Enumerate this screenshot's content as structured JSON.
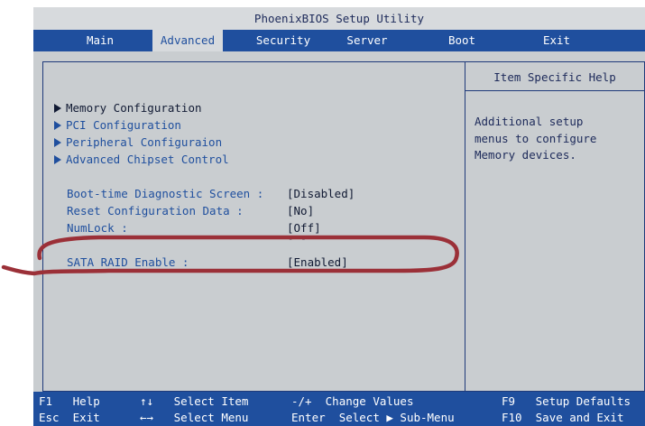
{
  "title": "PhoenixBIOS Setup Utility",
  "tabs": [
    {
      "label": "Main"
    },
    {
      "label": "Advanced"
    },
    {
      "label": "Security"
    },
    {
      "label": "Server"
    },
    {
      "label": "Boot"
    },
    {
      "label": "Exit"
    }
  ],
  "active_tab": "Advanced",
  "submenus": [
    {
      "label": "Memory Configuration"
    },
    {
      "label": "PCI Configuration"
    },
    {
      "label": "Peripheral Configuraion"
    },
    {
      "label": "Advanced Chipset Control"
    }
  ],
  "options": [
    {
      "name": "Boot-time Diagnostic Screen :",
      "value": "[Disabled]"
    },
    {
      "name": "Reset Configuration Data :",
      "value": "[No]"
    },
    {
      "name": "NumLock :",
      "value": "[Off]"
    },
    {
      "name": "SATA RAID Enable :",
      "value": "[Enabled]"
    }
  ],
  "help": {
    "heading": "Item Specific Help",
    "text": "Additional setup\nmenus to configure\nMemory devices."
  },
  "footer": {
    "row1": [
      {
        "key": "F1",
        "desc": "Help"
      },
      {
        "key": "↑↓",
        "desc": "Select Item"
      },
      {
        "key": "-/+",
        "desc": "Change Values"
      },
      {
        "key": "F9",
        "desc": "Setup Defaults"
      }
    ],
    "row2": [
      {
        "key": "Esc",
        "desc": "Exit"
      },
      {
        "key": "←→",
        "desc": "Select Menu"
      },
      {
        "key": "Enter",
        "desc": "Select ▶ Sub-Menu"
      },
      {
        "key": "F10",
        "desc": "Save and Exit"
      }
    ]
  },
  "colors": {
    "menubar": "#1f4f9e",
    "panel": "#c9cdd0",
    "annotation": "#9b3038"
  }
}
